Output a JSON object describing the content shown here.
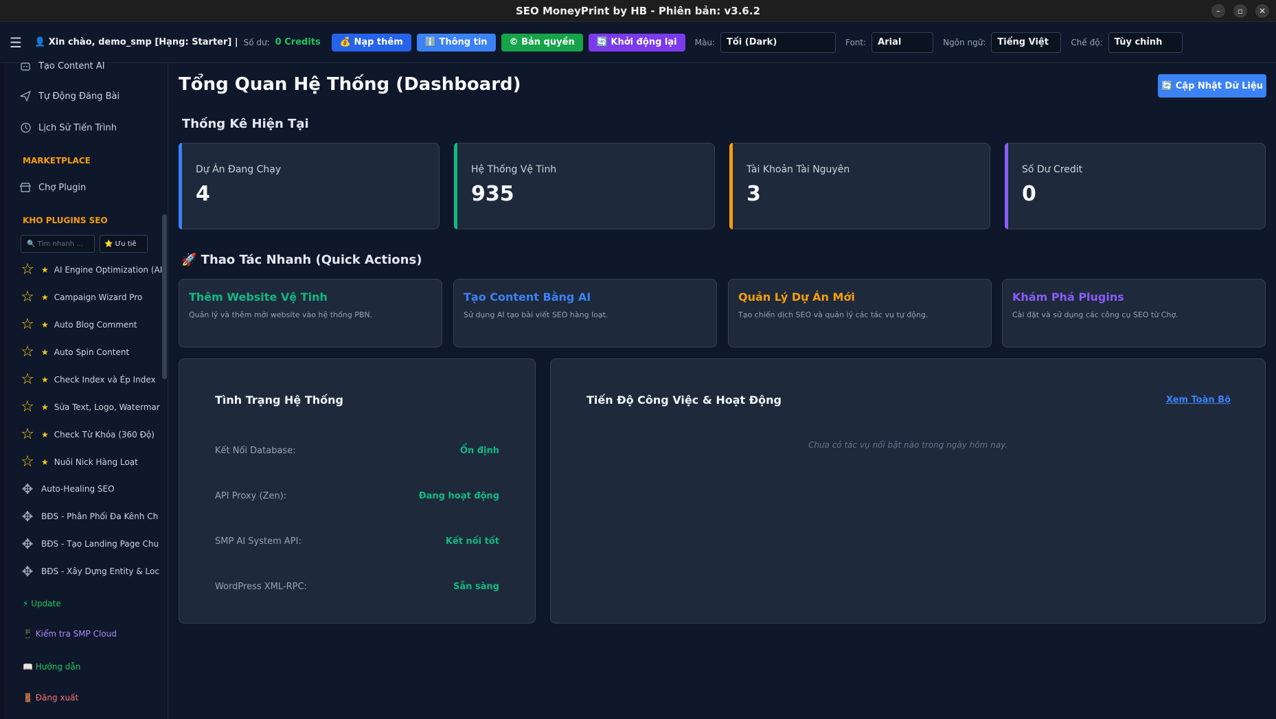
{
  "window": {
    "title": "SEO MoneyPrint by HB - Phiên bản: v3.6.2",
    "controls": [
      "–",
      "▫",
      "✕"
    ]
  },
  "toolbar": {
    "greeting": "👤 Xin chào, demo_smp [Hạng: Starter] |",
    "balance_label": "Số dư:",
    "credits": "0 Credits",
    "buttons": {
      "topup": "💰 Nạp thêm",
      "info": "ℹ️ Thông tin",
      "license": "© Bản quyền",
      "restart": "🔄 Khởi động lại"
    },
    "color_label": "Màu:",
    "color_value": "Tối (Dark)",
    "font_label": "Font:",
    "font_value": "Arial",
    "lang_label": "Ngôn ngữ:",
    "lang_value": "Tiếng Việt",
    "mode_label": "Chế độ:",
    "mode_value": "Tùy chỉnh"
  },
  "sidebar": {
    "items": [
      {
        "label": "Tạo Content AI"
      },
      {
        "label": "Tự Động Đăng Bài"
      },
      {
        "label": "Lịch Sử Tiến Trình"
      }
    ],
    "marketplace_title": "MARKETPLACE",
    "marketplace_item": "Chợ Plugin",
    "plugins_title": "KHO PLUGINS SEO",
    "search_placeholder": "🔍 Tìm nhanh ...",
    "fav_label": "⭐ Ưu tiê",
    "plugins": [
      {
        "label": "AI Engine Optimization (AI",
        "fav": true
      },
      {
        "label": "Campaign Wizard Pro",
        "fav": true
      },
      {
        "label": "Auto Blog Comment",
        "fav": true
      },
      {
        "label": "Auto Spin Content",
        "fav": true
      },
      {
        "label": "Check Index và Ép Index",
        "fav": true
      },
      {
        "label": "Sửa Text, Logo, Watermar",
        "fav": true
      },
      {
        "label": "Check Từ Khóa (360 Độ)",
        "fav": true
      },
      {
        "label": "Nuôi Nick Hàng Loạt",
        "fav": true
      },
      {
        "label": "Auto-Healing SEO",
        "fav": false
      },
      {
        "label": "BĐS - Phân Phối Đa Kênh Ch",
        "fav": false
      },
      {
        "label": "BĐS - Tạo Landing Page Chu",
        "fav": false
      },
      {
        "label": "BĐS - Xây Dựng Entity & Loc",
        "fav": false
      }
    ],
    "bottom": {
      "update": "⚡ Update",
      "cloud": "📱 Kiểm tra SMP Cloud",
      "guide": "📖 Hướng dẫn",
      "logout": "🚪 Đăng xuất"
    }
  },
  "main": {
    "title": "Tổng Quan Hệ Thống (Dashboard)",
    "refresh": "🔄 Cập Nhật Dữ Liệu",
    "stats_title": "Thống Kê Hiện Tại",
    "stats": [
      {
        "label": "Dự Án Đang Chạy",
        "value": "4",
        "color": "#3b82f6"
      },
      {
        "label": "Hệ Thống Vệ Tinh",
        "value": "935",
        "color": "#10b981"
      },
      {
        "label": "Tài Khoản Tài Nguyên",
        "value": "3",
        "color": "#f59e0b"
      },
      {
        "label": "Số Dư Credit",
        "value": "0",
        "color": "#8b5cf6"
      }
    ],
    "quick_title": "🚀 Thao Tác Nhanh (Quick Actions)",
    "quick": [
      {
        "title": "Thêm Website Vệ Tinh",
        "desc": "Quản lý và thêm mới website vào hệ thống PBN.",
        "color": "#10b981"
      },
      {
        "title": "Tạo Content Bằng AI",
        "desc": "Sử dụng AI tạo bài viết SEO hàng loạt.",
        "color": "#3b82f6"
      },
      {
        "title": "Quản Lý Dự Án Mới",
        "desc": "Tạo chiến dịch SEO và quản lý các tác vụ tự động.",
        "color": "#f59e0b"
      },
      {
        "title": "Khám Phá Plugins",
        "desc": "Cài đặt và sử dụng các công cụ SEO từ Chợ.",
        "color": "#8b5cf6"
      }
    ],
    "status": {
      "title": "Tình Trạng Hệ Thống",
      "rows": [
        {
          "key": "Kết Nối Database:",
          "value": "Ổn định"
        },
        {
          "key": "API Proxy (Zen):",
          "value": "Đang hoạt động"
        },
        {
          "key": "SMP AI System API:",
          "value": "Kết nối tốt"
        },
        {
          "key": "WordPress XML-RPC:",
          "value": "Sẵn sàng"
        }
      ]
    },
    "activity": {
      "title": "Tiến Độ Công Việc & Hoạt Động",
      "view_all": "Xem Toàn Bộ",
      "empty": "Chưa có tác vụ nổi bật nào trong ngày hôm nay."
    }
  }
}
